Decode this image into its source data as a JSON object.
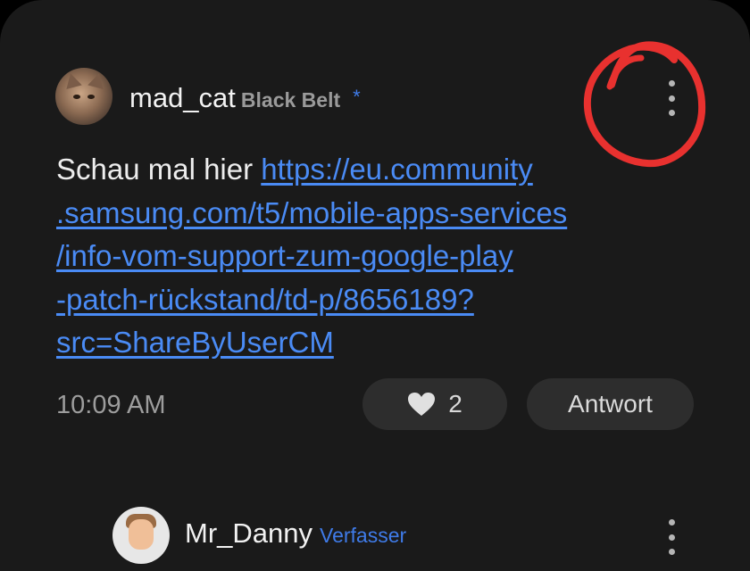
{
  "post": {
    "username": "mad_cat",
    "rank": "Black Belt",
    "star": "*",
    "text_prefix": "Schau mal hier",
    "link_lines": [
      "https://eu.community",
      ".samsung.com/t5/mobile-apps-services",
      "/info-vom-support-zum-google-play",
      "-patch-rückstand/td-p/8656189?",
      "src=ShareByUserCM"
    ],
    "link_url": "https://eu.community.samsung.com/t5/mobile-apps-services/info-vom-support-zum-google-play-patch-rückstand/td-p/8656189?src=ShareByUserCM",
    "time": "10:09 AM",
    "likes": "2",
    "reply_label": "Antwort"
  },
  "next_reply": {
    "username": "Mr_Danny",
    "role": "Verfasser"
  },
  "icons": {
    "avatar": "cat-photo-avatar",
    "more": "vertical-ellipsis-icon",
    "like": "heart-icon"
  },
  "colors": {
    "background": "#1a1a1a",
    "link": "#4a8bf5",
    "accent": "#3f7be8",
    "annotation": "#e8312f"
  }
}
